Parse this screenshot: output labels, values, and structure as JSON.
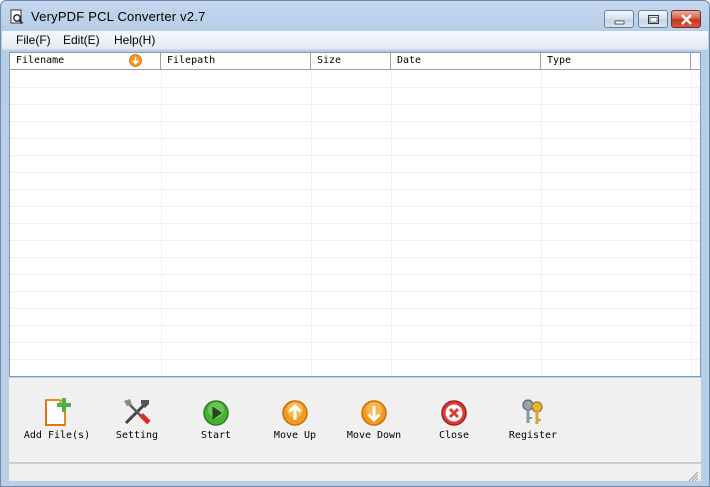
{
  "window": {
    "title": "VeryPDF PCL Converter v2.7"
  },
  "menu": {
    "items": [
      "File(F)",
      "Edit(E)",
      "Help(H)"
    ]
  },
  "list": {
    "columns": [
      "Filename",
      "Filepath",
      "Size",
      "Date",
      "Type"
    ],
    "sorted_column": "Filename",
    "rows": []
  },
  "toolbar": {
    "buttons": [
      {
        "label": "Add File(s)",
        "icon": "add-file-icon"
      },
      {
        "label": "Setting",
        "icon": "tools-icon"
      },
      {
        "label": "Start",
        "icon": "play-icon"
      },
      {
        "label": "Move Up",
        "icon": "arrow-up-icon"
      },
      {
        "label": "Move Down",
        "icon": "arrow-down-icon"
      },
      {
        "label": "Close",
        "icon": "close-circle-icon"
      },
      {
        "label": "Register",
        "icon": "keys-icon"
      }
    ]
  },
  "colors": {
    "accent_orange": "#f39a1c",
    "play_green": "#3c9b2a",
    "close_red": "#d92c2c"
  }
}
